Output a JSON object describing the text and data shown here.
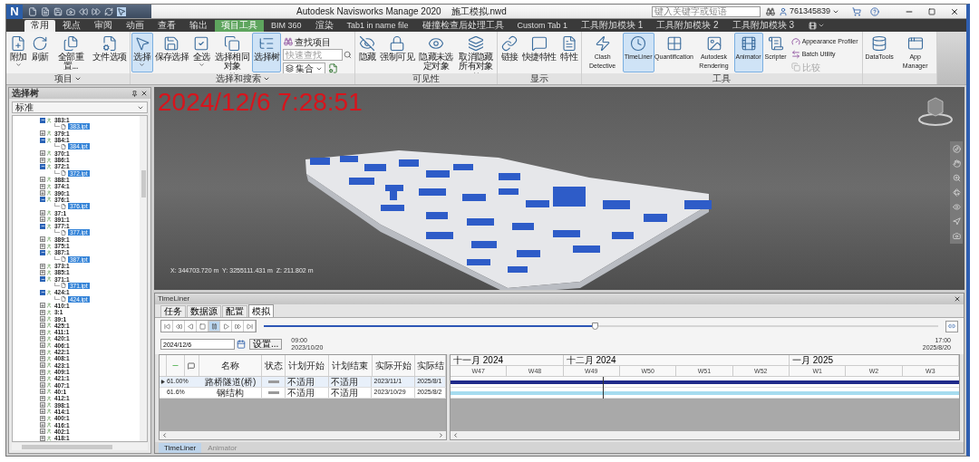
{
  "window": {
    "logo": "N",
    "title": "Autodesk Navisworks Manage 2020    施工模拟.nwd",
    "search_placeholder": "键入关键字或短语",
    "user": "761345839"
  },
  "ribbon_tabs": [
    {
      "label": "常用",
      "selected": true,
      "contextual": false
    },
    {
      "label": "视点",
      "selected": false,
      "contextual": false
    },
    {
      "label": "审阅",
      "selected": false,
      "contextual": false
    },
    {
      "label": "动画",
      "selected": false,
      "contextual": false
    },
    {
      "label": "查看",
      "selected": false,
      "contextual": false
    },
    {
      "label": "输出",
      "selected": false,
      "contextual": false
    },
    {
      "label": "项目工具",
      "selected": false,
      "contextual": true
    },
    {
      "label": "BIM 360",
      "selected": false,
      "contextual": false
    },
    {
      "label": "渲染",
      "selected": false,
      "contextual": false
    },
    {
      "label": "Tab1 in name file",
      "selected": false,
      "contextual": false
    },
    {
      "label": "碰撞检查后处理工具",
      "selected": false,
      "contextual": false
    },
    {
      "label": "Custom Tab 1",
      "selected": false,
      "contextual": false
    },
    {
      "label": "工具附加模块 1",
      "selected": false,
      "contextual": false
    },
    {
      "label": "工具附加模块 2",
      "selected": false,
      "contextual": false
    },
    {
      "label": "工具附加模块 3",
      "selected": false,
      "contextual": false
    }
  ],
  "ribbon_groups": [
    {
      "label": "项目",
      "menu": true,
      "items": [
        {
          "kind": "large",
          "label": "附加",
          "active": false,
          "dropdown": true
        },
        {
          "kind": "large",
          "label": "刷新",
          "active": false,
          "dropdown": false
        },
        {
          "kind": "large",
          "label": "全部重置...",
          "active": false,
          "dropdown": false
        },
        {
          "kind": "large",
          "label": "文件选项",
          "active": false,
          "dropdown": false
        }
      ]
    },
    {
      "label": "选择和搜索",
      "menu": true,
      "items": [
        {
          "kind": "large",
          "label": "选择",
          "active": true,
          "dropdown": true
        },
        {
          "kind": "large",
          "label": "保存选择",
          "active": false,
          "dropdown": false
        },
        {
          "kind": "large",
          "label": "全选",
          "active": false,
          "dropdown": true
        },
        {
          "kind": "large",
          "label": "选择相同对象",
          "active": false,
          "dropdown": true
        },
        {
          "kind": "large",
          "label": "选择树",
          "active": true,
          "dropdown": false
        },
        {
          "kind": "small",
          "label": "查找项目",
          "active": false,
          "disabled": false
        },
        {
          "kind": "field",
          "placeholder": "快速查找"
        },
        {
          "kind": "select",
          "label": "集合"
        }
      ]
    },
    {
      "label": "可见性",
      "items": [
        {
          "kind": "large",
          "label": "隐藏",
          "active": false,
          "dropdown": false
        },
        {
          "kind": "large",
          "label": "强制可见",
          "active": false,
          "dropdown": false
        },
        {
          "kind": "large",
          "label": "隐藏未选定对象",
          "active": false,
          "dropdown": false
        },
        {
          "kind": "large",
          "label": "取消隐藏所有对象",
          "active": false,
          "dropdown": true
        }
      ]
    },
    {
      "label": "显示",
      "items": [
        {
          "kind": "large",
          "label": "链接",
          "active": false,
          "dropdown": false
        },
        {
          "kind": "large",
          "label": "快捷特性",
          "active": false,
          "dropdown": false
        },
        {
          "kind": "large",
          "label": "特性",
          "active": false,
          "dropdown": false
        }
      ]
    },
    {
      "label": "工具",
      "items": [
        {
          "kind": "large",
          "label": "Clash Detective",
          "active": false,
          "dropdown": false
        },
        {
          "kind": "large",
          "label": "TimeLiner",
          "active": true,
          "dropdown": false
        },
        {
          "kind": "large",
          "label": "Quantification",
          "active": false,
          "dropdown": false
        },
        {
          "kind": "large",
          "label": "Autodesk Rendering",
          "active": false,
          "dropdown": false
        },
        {
          "kind": "large",
          "label": "Animator",
          "active": true,
          "dropdown": false
        },
        {
          "kind": "large",
          "label": "Scripter",
          "active": false,
          "dropdown": false
        },
        {
          "kind": "small",
          "label": "Appearance Profiler",
          "active": false,
          "disabled": false
        },
        {
          "kind": "small",
          "label": "Batch Utility",
          "active": false,
          "disabled": false
        },
        {
          "kind": "small",
          "label": "比较",
          "active": false,
          "disabled": true
        }
      ]
    },
    {
      "items": [
        {
          "kind": "large",
          "label": "DataTools",
          "active": false,
          "dropdown": false
        },
        {
          "kind": "large",
          "label": "App Manager",
          "active": false,
          "dropdown": false
        }
      ]
    }
  ],
  "selection_tree": {
    "title": "选择树",
    "mode": "标准",
    "items": [
      {
        "label": "383:1",
        "expanded": true,
        "selected": false,
        "children": [
          {
            "label": "383.ipt",
            "selected": true
          }
        ]
      },
      {
        "label": "379:1",
        "expanded": false,
        "selected": false
      },
      {
        "label": "384:1",
        "expanded": true,
        "selected": false,
        "children": [
          {
            "label": "384.ipt",
            "selected": true
          }
        ]
      },
      {
        "label": "370:1",
        "expanded": false,
        "selected": false
      },
      {
        "label": "386:1",
        "expanded": false,
        "selected": false
      },
      {
        "label": "372:1",
        "expanded": true,
        "selected": false,
        "children": [
          {
            "label": "372.ipt",
            "selected": true
          }
        ]
      },
      {
        "label": "388:1",
        "expanded": false,
        "selected": false
      },
      {
        "label": "374:1",
        "expanded": false,
        "selected": false
      },
      {
        "label": "390:1",
        "expanded": false,
        "selected": false
      },
      {
        "label": "376:1",
        "expanded": true,
        "selected": false,
        "children": [
          {
            "label": "376.ipt",
            "selected": true
          }
        ]
      },
      {
        "label": "37:1",
        "expanded": false,
        "selected": false
      },
      {
        "label": "391:1",
        "expanded": false,
        "selected": false
      },
      {
        "label": "377:1",
        "expanded": true,
        "selected": false,
        "children": [
          {
            "label": "377.ipt",
            "selected": true
          }
        ]
      },
      {
        "label": "389:1",
        "expanded": false,
        "selected": false
      },
      {
        "label": "375:1",
        "expanded": false,
        "selected": false
      },
      {
        "label": "387:1",
        "expanded": true,
        "selected": false,
        "children": [
          {
            "label": "387.ipt",
            "selected": true
          }
        ]
      },
      {
        "label": "373:1",
        "expanded": false,
        "selected": false
      },
      {
        "label": "385:1",
        "expanded": false,
        "selected": false
      },
      {
        "label": "371:1",
        "expanded": true,
        "selected": false,
        "children": [
          {
            "label": "371.ipt",
            "selected": true
          }
        ]
      },
      {
        "label": "424:1",
        "expanded": true,
        "selected": false,
        "children": [
          {
            "label": "424.ipt",
            "selected": true
          }
        ]
      },
      {
        "label": "410:1",
        "expanded": false,
        "selected": false
      },
      {
        "label": "3:1",
        "expanded": false,
        "selected": false
      },
      {
        "label": "39:1",
        "expanded": false,
        "selected": false
      },
      {
        "label": "425:1",
        "expanded": false,
        "selected": false
      },
      {
        "label": "411:1",
        "expanded": false,
        "selected": false
      },
      {
        "label": "420:1",
        "expanded": false,
        "selected": false
      },
      {
        "label": "406:1",
        "expanded": false,
        "selected": false
      },
      {
        "label": "422:1",
        "expanded": false,
        "selected": false
      },
      {
        "label": "408:1",
        "expanded": false,
        "selected": false
      },
      {
        "label": "423:1",
        "expanded": false,
        "selected": false
      },
      {
        "label": "409:1",
        "expanded": false,
        "selected": false
      },
      {
        "label": "421:1",
        "expanded": false,
        "selected": false
      },
      {
        "label": "407:1",
        "expanded": false,
        "selected": false
      },
      {
        "label": "40:1",
        "expanded": false,
        "selected": false
      },
      {
        "label": "412:1",
        "expanded": false,
        "selected": false
      },
      {
        "label": "398:1",
        "expanded": false,
        "selected": false
      },
      {
        "label": "414:1",
        "expanded": false,
        "selected": false
      },
      {
        "label": "400:1",
        "expanded": false,
        "selected": false
      },
      {
        "label": "416:1",
        "expanded": false,
        "selected": false
      },
      {
        "label": "402:1",
        "expanded": false,
        "selected": false
      },
      {
        "label": "418:1",
        "expanded": false,
        "selected": false
      }
    ]
  },
  "viewport": {
    "timestamp": "2024/12/6 7:28:51",
    "coordinates": "X: 344703.720 m  Y: 3255111.431 m  Z: 211.802 m"
  },
  "timeliner": {
    "title": "TimeLiner",
    "tabs": [
      {
        "label": "任务",
        "selected": false
      },
      {
        "label": "数据源",
        "selected": false
      },
      {
        "label": "配置",
        "selected": false
      },
      {
        "label": "模拟",
        "selected": true
      }
    ],
    "playback": [
      {
        "selected": false
      },
      {
        "selected": false
      },
      {
        "selected": false
      },
      {
        "selected": false
      },
      {
        "selected": true
      },
      {
        "selected": false
      },
      {
        "selected": false
      },
      {
        "selected": false
      }
    ],
    "slider": {
      "level": 0.49
    },
    "date_value": "2024/12/6",
    "settings_button": "设置...",
    "start_time": "09:00",
    "start_date": "2023/10/20",
    "end_time": "17:00",
    "end_date": "2025/8/20",
    "columns": [
      "名称",
      "状态",
      "计划开始",
      "计划结束",
      "实际开始",
      "实际结"
    ],
    "rows": [
      {
        "selected": true,
        "progress": "61.00%",
        "name": "路桥隧道(桥)",
        "planned_start": "不适用",
        "planned_end": "不适用",
        "actual_start": "2023/11/1",
        "actual_end": "2025/8/1",
        "color": "#1f2a8a"
      },
      {
        "selected": false,
        "progress": "61.6%",
        "name": "钢结构",
        "planned_start": "不适用",
        "planned_end": "不适用",
        "actual_start": "2023/10/29",
        "actual_end": "2025/8/2",
        "color": "#a6dcef"
      }
    ],
    "months": [
      "十一月 2024",
      "十二月 2024",
      "一月 2025"
    ],
    "weeks": [
      "W47",
      "W48",
      "W49",
      "W50",
      "W51",
      "W52",
      "W1",
      "W2",
      "W3"
    ],
    "bottom_tabs": [
      {
        "label": "TimeLiner",
        "selected": true
      },
      {
        "label": "Animator",
        "selected": false
      }
    ]
  }
}
